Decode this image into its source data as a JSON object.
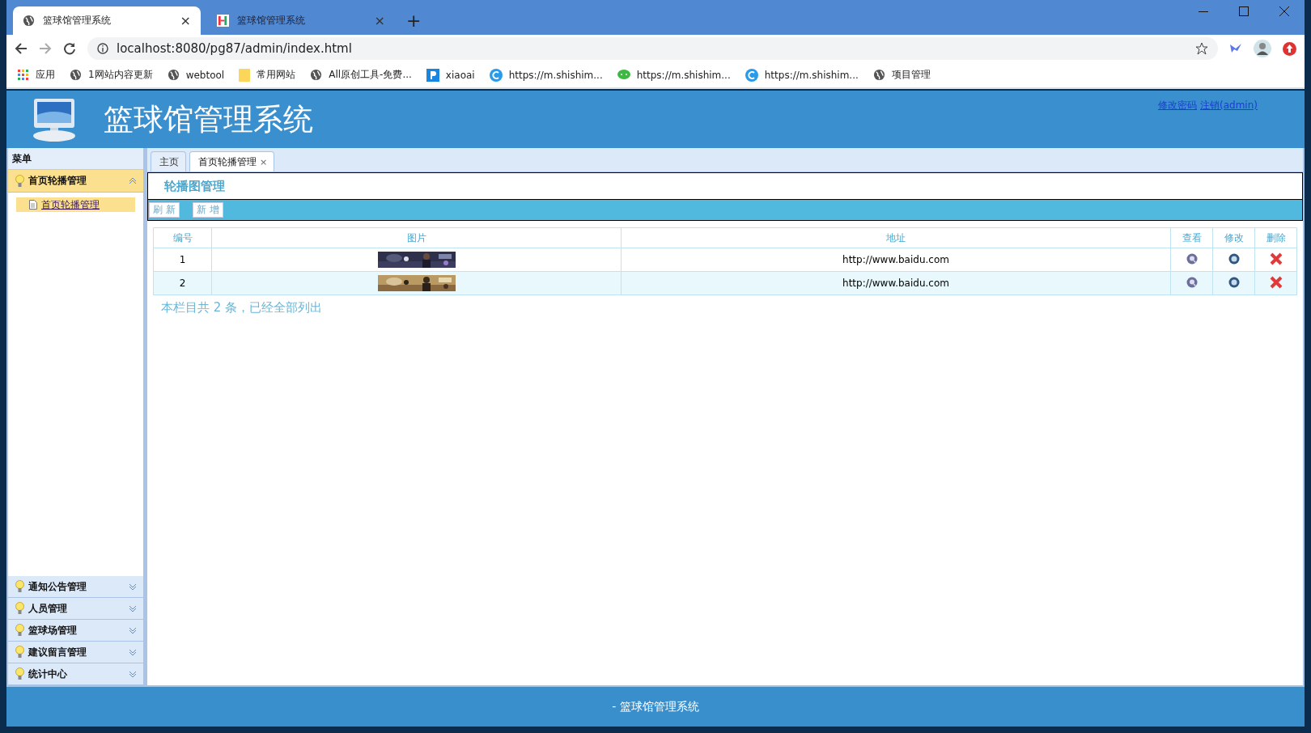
{
  "browser": {
    "tabs": [
      {
        "title": "篮球馆管理系统",
        "selected": true,
        "close": "×"
      },
      {
        "title": "篮球馆管理系统",
        "selected": false,
        "close": "×"
      }
    ],
    "new_tab": "+",
    "address": "localhost:8080/pg87/admin/index.html",
    "bookmarks": [
      {
        "label": "应用",
        "kind": "apps"
      },
      {
        "label": "1网站内容更新",
        "kind": "globe"
      },
      {
        "label": "webtool",
        "kind": "globe"
      },
      {
        "label": "常用网站",
        "kind": "folder"
      },
      {
        "label": "All原创工具-免费...",
        "kind": "globe"
      },
      {
        "label": "xiaoai",
        "kind": "p"
      },
      {
        "label": "https://m.shishim...",
        "kind": "c"
      },
      {
        "label": "https://m.shishim...",
        "kind": "chat"
      },
      {
        "label": "https://m.shishim...",
        "kind": "c"
      },
      {
        "label": "项目管理",
        "kind": "globe"
      }
    ]
  },
  "header": {
    "title": "篮球馆管理系统",
    "links": [
      "修改密码",
      "注销(admin)"
    ]
  },
  "sidebar": {
    "title": "菜单",
    "groups": [
      {
        "label": "首页轮播管理",
        "expanded": true,
        "items": [
          {
            "label": "首页轮播管理",
            "selected": true
          }
        ]
      },
      {
        "label": "通知公告管理",
        "expanded": false
      },
      {
        "label": "人员管理",
        "expanded": false
      },
      {
        "label": "篮球场管理",
        "expanded": false
      },
      {
        "label": "建议留言管理",
        "expanded": false
      },
      {
        "label": "统计中心",
        "expanded": false
      }
    ]
  },
  "tabs": [
    {
      "label": "主页",
      "selected": false
    },
    {
      "label": "首页轮播管理",
      "selected": true,
      "close": "×"
    }
  ],
  "panel": {
    "title": "轮播图管理",
    "buttons": [
      "刷 新",
      "新 增"
    ]
  },
  "table": {
    "columns": [
      "编号",
      "图片",
      "地址",
      "查看",
      "修改",
      "删除"
    ],
    "rows": [
      {
        "id": "1",
        "url": "http://www.baidu.com"
      },
      {
        "id": "2",
        "url": "http://www.baidu.com"
      }
    ],
    "summary": "本栏目共 2 条，已经全部列出"
  },
  "footer": "- 篮球馆管理系统"
}
